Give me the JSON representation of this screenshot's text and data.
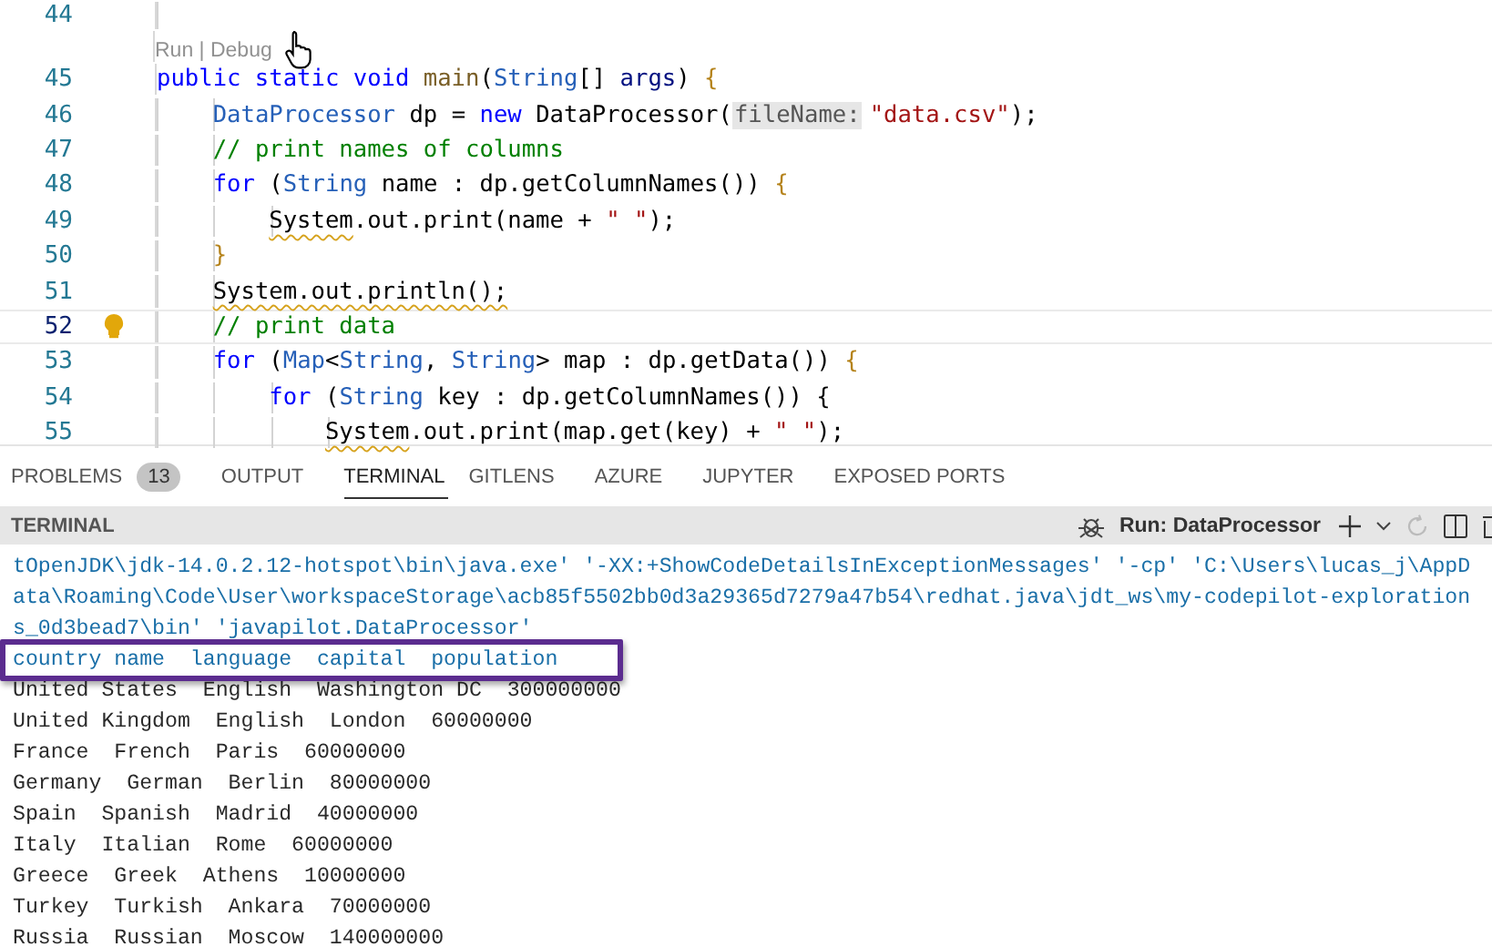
{
  "editor": {
    "code_lens": "Run | Debug",
    "lines": [
      {
        "number": "44",
        "current": false,
        "lightbulb": false,
        "lens_before": false
      },
      {
        "number": "45",
        "current": false,
        "lightbulb": false,
        "lens_before": true,
        "tokens": [
          {
            "kind": "kw",
            "text": "public static void "
          },
          {
            "kind": "fn",
            "text": "main"
          },
          {
            "kind": "plain",
            "text": "("
          },
          {
            "kind": "type",
            "text": "String"
          },
          {
            "kind": "plain",
            "text": "[] "
          },
          {
            "kind": "var",
            "text": "args"
          },
          {
            "kind": "plain",
            "text": ") "
          },
          {
            "kind": "brace",
            "text": "{"
          }
        ]
      },
      {
        "number": "46",
        "current": false,
        "lightbulb": false,
        "lens_before": false,
        "tokens": [
          {
            "kind": "type",
            "text": "    DataProcessor"
          },
          {
            "kind": "plain",
            "text": " dp = "
          },
          {
            "kind": "kw",
            "text": "new"
          },
          {
            "kind": "plain",
            "text": " DataProcessor("
          },
          {
            "kind": "hint",
            "text": "fileName:"
          },
          {
            "kind": "str",
            "text": "\"data.csv\""
          },
          {
            "kind": "plain",
            "text": ");"
          }
        ]
      },
      {
        "number": "47",
        "current": false,
        "lightbulb": false,
        "lens_before": false,
        "tokens": [
          {
            "kind": "cmt",
            "text": "    // print names of columns"
          }
        ]
      },
      {
        "number": "48",
        "current": false,
        "lightbulb": false,
        "lens_before": false,
        "tokens": [
          {
            "kind": "kw",
            "text": "    for"
          },
          {
            "kind": "plain",
            "text": " ("
          },
          {
            "kind": "type",
            "text": "String"
          },
          {
            "kind": "plain",
            "text": " name : dp.getColumnNames()) "
          },
          {
            "kind": "brace",
            "text": "{"
          }
        ]
      },
      {
        "number": "49",
        "current": false,
        "lightbulb": false,
        "lens_before": false,
        "tokens": [
          {
            "kind": "warn",
            "text": "        System"
          },
          {
            "kind": "plain",
            "text": ".out.print(name + "
          },
          {
            "kind": "str",
            "text": "\" \""
          },
          {
            "kind": "plain",
            "text": ");"
          }
        ]
      },
      {
        "number": "50",
        "current": false,
        "lightbulb": false,
        "lens_before": false,
        "tokens": [
          {
            "kind": "brace",
            "text": "    }"
          }
        ]
      },
      {
        "number": "51",
        "current": false,
        "lightbulb": false,
        "lens_before": false,
        "tokens": [
          {
            "kind": "warn",
            "text": "    System.out.println();"
          }
        ]
      },
      {
        "number": "52",
        "current": true,
        "lightbulb": true,
        "lens_before": false,
        "tokens": [
          {
            "kind": "cmt",
            "text": "    // print data"
          }
        ]
      },
      {
        "number": "53",
        "current": false,
        "lightbulb": false,
        "lens_before": false,
        "tokens": [
          {
            "kind": "kw",
            "text": "    for"
          },
          {
            "kind": "plain",
            "text": " ("
          },
          {
            "kind": "type",
            "text": "Map"
          },
          {
            "kind": "plain",
            "text": "<"
          },
          {
            "kind": "type",
            "text": "String"
          },
          {
            "kind": "plain",
            "text": ", "
          },
          {
            "kind": "type",
            "text": "String"
          },
          {
            "kind": "plain",
            "text": "> map : dp.getData()) "
          },
          {
            "kind": "brace",
            "text": "{"
          }
        ]
      },
      {
        "number": "54",
        "current": false,
        "lightbulb": false,
        "lens_before": false,
        "tokens": [
          {
            "kind": "kw",
            "text": "        for"
          },
          {
            "kind": "plain",
            "text": " ("
          },
          {
            "kind": "type",
            "text": "String"
          },
          {
            "kind": "plain",
            "text": " key : dp.getColumnNames()) {"
          }
        ]
      },
      {
        "number": "55",
        "current": false,
        "lightbulb": false,
        "lens_before": false,
        "tokens": [
          {
            "kind": "warn",
            "text": "            System"
          },
          {
            "kind": "plain",
            "text": ".out.print(map.get(key) + "
          },
          {
            "kind": "str",
            "text": "\" \""
          },
          {
            "kind": "plain",
            "text": ");"
          }
        ]
      }
    ]
  },
  "panel_tabs": [
    {
      "label": "PROBLEMS",
      "badge": "13",
      "selected": false
    },
    {
      "label": "OUTPUT",
      "selected": false
    },
    {
      "label": "TERMINAL",
      "selected": true
    },
    {
      "label": "GITLENS",
      "selected": false
    },
    {
      "label": "AZURE",
      "selected": false
    },
    {
      "label": "JUPYTER",
      "selected": false
    },
    {
      "label": "EXPOSED PORTS",
      "selected": false
    }
  ],
  "terminal": {
    "title": "TERMINAL",
    "session": "Run: DataProcessor",
    "lines": [
      "tOpenJDK\\jdk-14.0.2.12-hotspot\\bin\\java.exe' '-XX:+ShowCodeDetailsInExceptionMessages' '-cp' 'C:\\Users\\lucas_j\\AppD",
      "ata\\Roaming\\Code\\User\\workspaceStorage\\acb85f5502bb0d3a29365d7279a47b54\\redhat.java\\jdt_ws\\my-codepilot-exploration",
      "s_0d3bead7\\bin' 'javapilot.DataProcessor'",
      "country name  language  capital  population",
      "United States  English  Washington DC  300000000",
      "United Kingdom  English  London  60000000",
      "France  French  Paris  60000000",
      "Germany  German  Berlin  80000000",
      "Spain  Spanish  Madrid  40000000",
      "Italy  Italian  Rome  60000000",
      "Greece  Greek  Athens  10000000",
      "Turkey  Turkish  Ankara  70000000",
      "Russia  Russian  Moscow  140000000"
    ],
    "highlighted": [
      false,
      false,
      false,
      true,
      false,
      false,
      false,
      false,
      false,
      false,
      false,
      false,
      false
    ]
  }
}
